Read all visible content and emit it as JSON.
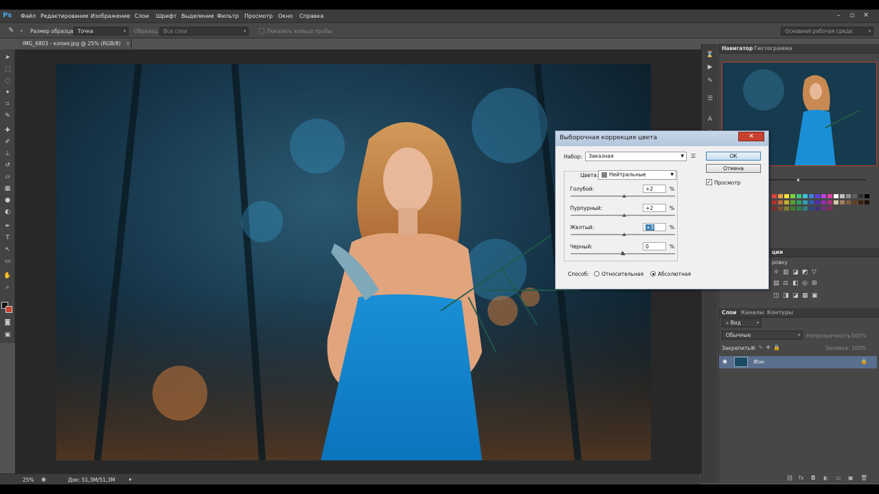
{
  "app": {
    "logo": "Ps",
    "menu": [
      "Файл",
      "Редактирование",
      "Изображение",
      "Слои",
      "Шрифт",
      "Выделение",
      "Фильтр",
      "Просмотр",
      "Окно",
      "Справка"
    ]
  },
  "options": {
    "sample_size_label": "Размер образца:",
    "sample_size_value": "Точка",
    "sample_label": "Образец:",
    "sample_value": "Все слои",
    "show_ring": "Показать кольцо пробы",
    "workspace": "Основная рабочая среда"
  },
  "document": {
    "tab_title": "IMG_6803 - копия.jpg @ 25% (RGB/8)",
    "tab_close": "×"
  },
  "status": {
    "zoom": "25%",
    "doc": "Док: 51,3M/51,3M"
  },
  "panels": {
    "navigator_tabs": [
      "Навигатор",
      "Гистограмма"
    ],
    "layers_tabs": [
      "Слои",
      "Каналы",
      "Контуры"
    ],
    "kind_label": "Вид",
    "blend_mode": "Обычные",
    "opacity_label": "Непрозрачность:",
    "opacity_value": "100%",
    "lock_label": "Закрепить:",
    "fill_label": "Заливка:",
    "fill_value": "100%",
    "layer_name": "Фон",
    "corrections_label": "ции",
    "presets_label": "ровку"
  },
  "dialog": {
    "title": "Выборочная коррекция цвета",
    "close": "✕",
    "preset_label": "Набор:",
    "preset_value": "Заказная",
    "colors_label": "Цвета:",
    "colors_value": "Нейтральные",
    "ok": "OK",
    "cancel": "Отмена",
    "preview_label": "Просмотр",
    "preview_checked": true,
    "sliders": [
      {
        "label": "Голубой:",
        "value": "+2",
        "unit": "%",
        "level": 0.51
      },
      {
        "label": "Пурпурный:",
        "value": "+2",
        "unit": "%",
        "level": 0.51
      },
      {
        "label": "Желтый:",
        "value": "+3",
        "unit": "%",
        "level": 0.515
      },
      {
        "label": "Черный:",
        "value": "0",
        "unit": "%",
        "level": 0.5
      }
    ],
    "method_label": "Способ:",
    "method_relative": "Относительная",
    "method_absolute": "Абсолютная",
    "method_selected": "absolute"
  },
  "colors": {
    "accent": "#3c7fb1",
    "close": "#c8402f",
    "selected_layer": "#5a6e8e"
  }
}
